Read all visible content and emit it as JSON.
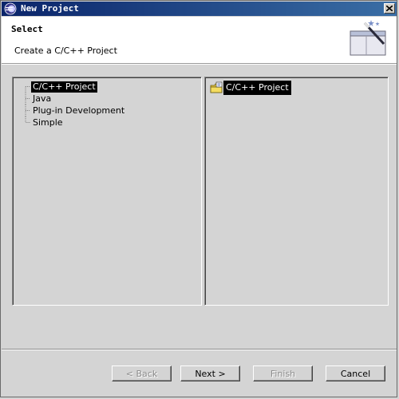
{
  "window": {
    "title": "New Project"
  },
  "header": {
    "title": "Select",
    "description": "Create a C/C++ Project"
  },
  "wizard_types": {
    "items": [
      {
        "label": "C/C++ Project",
        "selected": true
      },
      {
        "label": "Java",
        "selected": false
      },
      {
        "label": "Plug-in Development",
        "selected": false
      },
      {
        "label": "Simple",
        "selected": false
      }
    ]
  },
  "templates": {
    "items": [
      {
        "label": "C/C++ Project",
        "selected": true,
        "icon": "project-folder-icon"
      }
    ]
  },
  "buttons": {
    "back": "< Back",
    "next": "Next >",
    "finish": "Finish",
    "cancel": "Cancel"
  },
  "colors": {
    "titlebar": "#0a246a",
    "selection": "#000000",
    "dialog_bg": "#d4d4d4"
  }
}
